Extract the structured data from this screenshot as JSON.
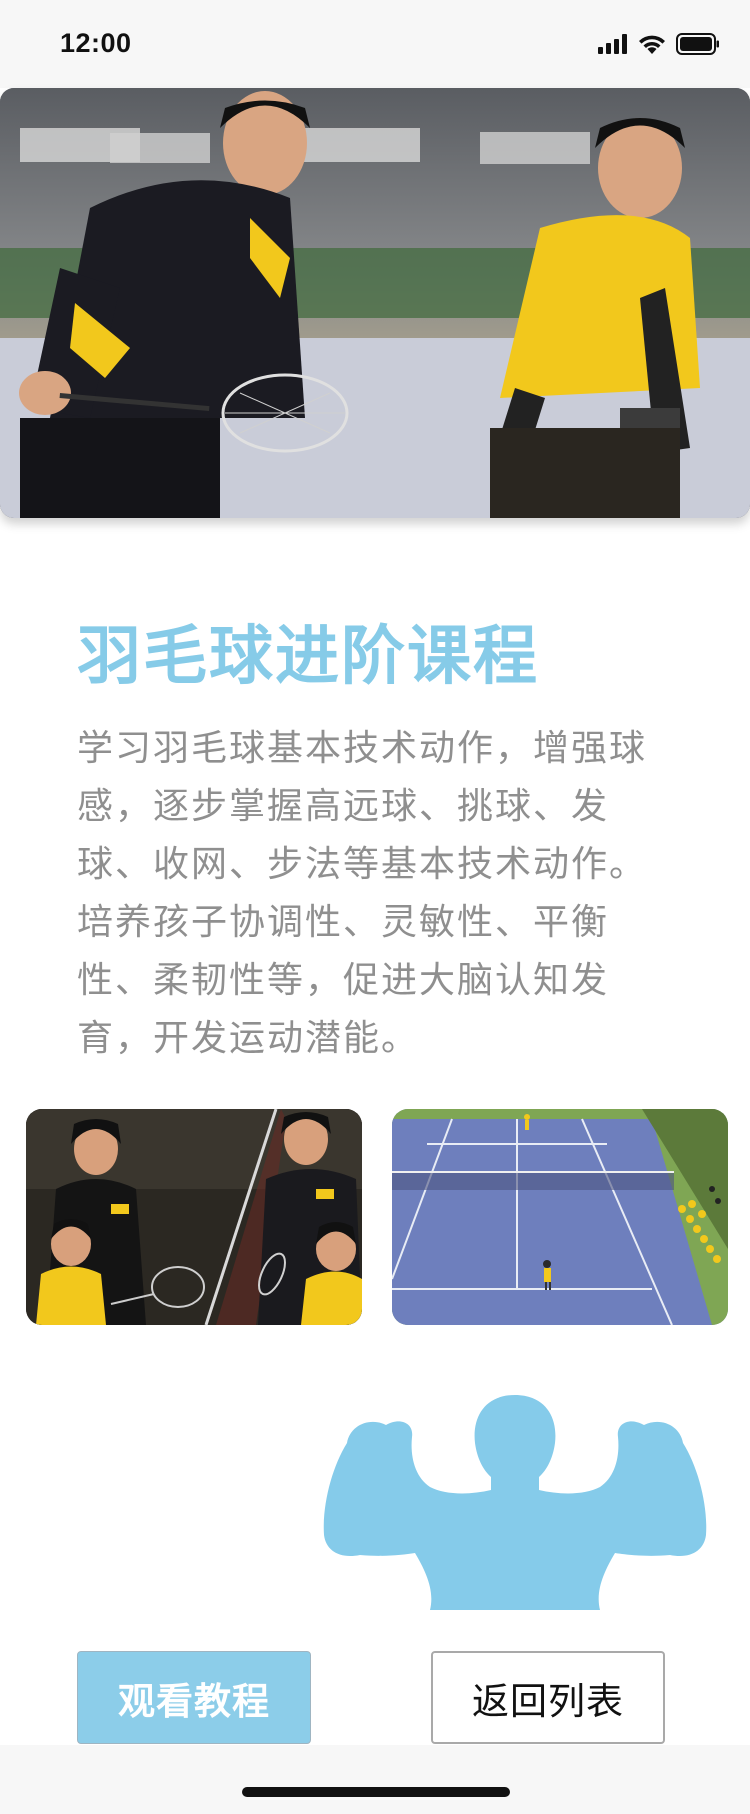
{
  "status_bar": {
    "time": "12:00",
    "icons": [
      "signal-icon",
      "wifi-icon",
      "battery-icon"
    ]
  },
  "course": {
    "title": "羽毛球进阶课程",
    "description": "学习羽毛球基本技术动作，增强球感，逐步掌握高远球、挑球、发球、收网、步法等基本技术动作。培养孩子协调性、灵敏性、平衡性、柔韧性等，促进大脑认知发育，开发运动潜能。"
  },
  "images": {
    "hero": "badminton-coach-and-student-photo",
    "left": "coaches-with-children-at-net-photo",
    "right": "blue-court-training-photo",
    "figure": "strong-man-silhouette-icon"
  },
  "buttons": {
    "watch": "观看教程",
    "back": "返回列表"
  },
  "colors": {
    "accent": "#86cbe8",
    "button_primary": "#8ccde9",
    "description_text": "#8f8f8f",
    "jersey_yellow": "#f2c81c"
  }
}
